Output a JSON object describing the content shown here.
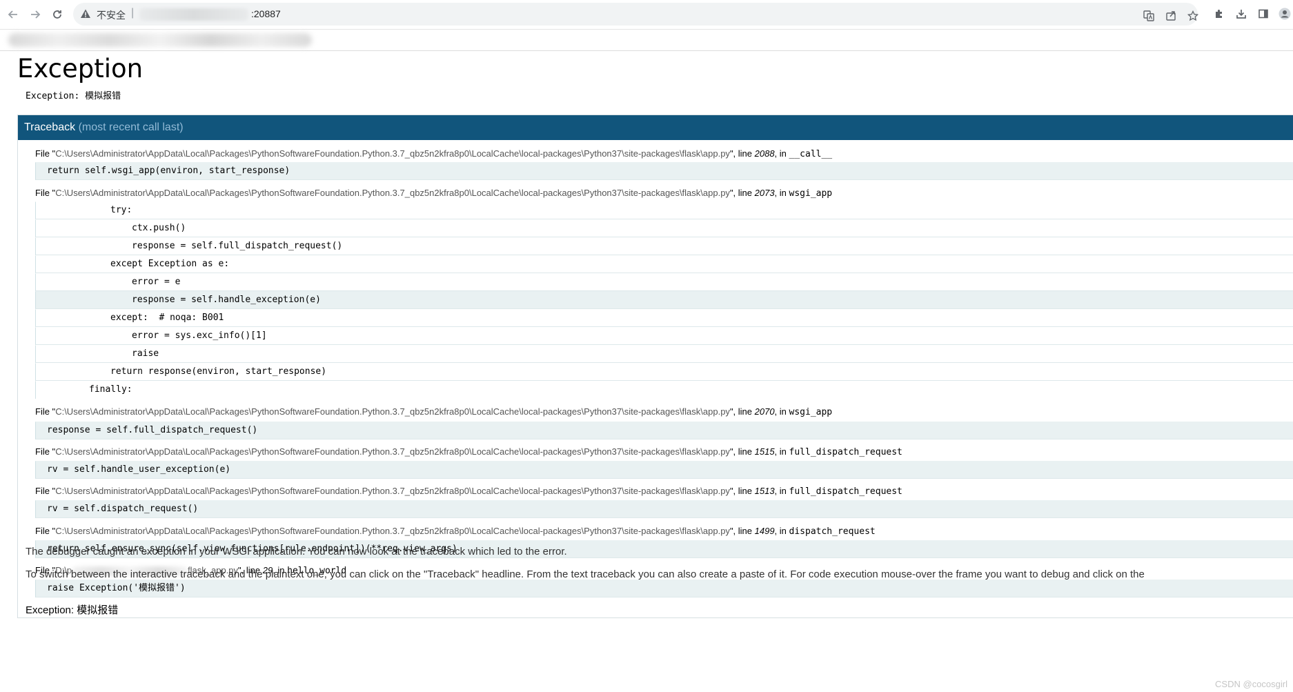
{
  "browser": {
    "insecure_label": "不安全",
    "url_separator": "|",
    "url_suffix": ":20887"
  },
  "page": {
    "title": "Exception",
    "error_message": "Exception: 模拟报错",
    "traceback_title": "Traceback",
    "traceback_subtitle": "(most recent call last)",
    "final_exception_prefix": "Exception:",
    "final_exception_text": "模拟报错",
    "explanation_1": "The debugger caught an exception in your WSGI application. You can now look at the traceback which led to the error.",
    "explanation_2": "To switch between the interactive traceback and the plaintext one, you can click on the \"Traceback\" headline. From the text traceback you can also create a paste of it. For code execution mouse-over the frame you want to debug and click on the",
    "watermark": "CSDN @cocosgirl"
  },
  "frames": [
    {
      "file_prefix": "File \"",
      "path": "C:\\Users\\Administrator\\AppData\\Local\\Packages\\PythonSoftwareFoundation.Python.3.7_qbz5n2kfra8p0\\LocalCache\\local-packages\\Python37\\site-packages\\flask\\app.py",
      "line_label": "\", line ",
      "line_no": "2088",
      "in_label": ", in ",
      "function": "__call__",
      "code": [
        "return self.wsgi_app(environ, start_response)"
      ]
    },
    {
      "file_prefix": "File \"",
      "path": "C:\\Users\\Administrator\\AppData\\Local\\Packages\\PythonSoftwareFoundation.Python.3.7_qbz5n2kfra8p0\\LocalCache\\local-packages\\Python37\\site-packages\\flask\\app.py",
      "line_label": "\", line ",
      "line_no": "2073",
      "in_label": ", in ",
      "function": "wsgi_app",
      "code": [
        "try:",
        "ctx.push()",
        "response = self.full_dispatch_request()",
        "except Exception as e:",
        "error = e",
        "response = self.handle_exception(e)",
        "except:  # noqa: B001",
        "error = sys.exc_info()[1]",
        "raise",
        "return response(environ, start_response)",
        "finally:"
      ]
    },
    {
      "file_prefix": "File \"",
      "path": "C:\\Users\\Administrator\\AppData\\Local\\Packages\\PythonSoftwareFoundation.Python.3.7_qbz5n2kfra8p0\\LocalCache\\local-packages\\Python37\\site-packages\\flask\\app.py",
      "line_label": "\", line ",
      "line_no": "2070",
      "in_label": ", in ",
      "function": "wsgi_app",
      "code": [
        "response = self.full_dispatch_request()"
      ]
    },
    {
      "file_prefix": "File \"",
      "path": "C:\\Users\\Administrator\\AppData\\Local\\Packages\\PythonSoftwareFoundation.Python.3.7_qbz5n2kfra8p0\\LocalCache\\local-packages\\Python37\\site-packages\\flask\\app.py",
      "line_label": "\", line ",
      "line_no": "1515",
      "in_label": ", in ",
      "function": "full_dispatch_request",
      "code": [
        "rv = self.handle_user_exception(e)"
      ]
    },
    {
      "file_prefix": "File \"",
      "path": "C:\\Users\\Administrator\\AppData\\Local\\Packages\\PythonSoftwareFoundation.Python.3.7_qbz5n2kfra8p0\\LocalCache\\local-packages\\Python37\\site-packages\\flask\\app.py",
      "line_label": "\", line ",
      "line_no": "1513",
      "in_label": ", in ",
      "function": "full_dispatch_request",
      "code": [
        "rv = self.dispatch_request()"
      ]
    },
    {
      "file_prefix": "File \"",
      "path": "C:\\Users\\Administrator\\AppData\\Local\\Packages\\PythonSoftwareFoundation.Python.3.7_qbz5n2kfra8p0\\LocalCache\\local-packages\\Python37\\site-packages\\flask\\app.py",
      "line_label": "\", line ",
      "line_no": "1499",
      "in_label": ", in ",
      "function": "dispatch_request",
      "code": [
        "return self.ensure_sync(self.view_functions[rule.endpoint])(**req.view_args)"
      ]
    },
    {
      "file_prefix": "File \"",
      "path_start": "D:\\p",
      "path_end": "flask_app.py",
      "line_label": "\", line ",
      "line_no": "29",
      "in_label": ", in ",
      "function": "hello_world",
      "code": [
        "raise Exception('模拟报错')"
      ]
    }
  ]
}
